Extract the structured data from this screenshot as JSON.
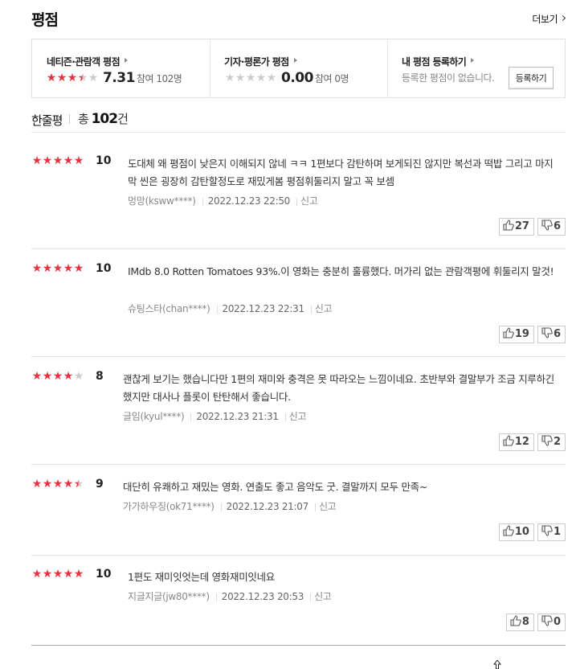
{
  "header": {
    "title": "평점",
    "more": "더보기"
  },
  "summary": {
    "netizen": {
      "label": "네티즌·관람객 평점",
      "score": "7.31",
      "participants": "참여 102명",
      "stars_fraction": 0.731
    },
    "critic": {
      "label": "기자·평론가 평점",
      "score": "0.00",
      "participants": "참여 0명",
      "stars_fraction": 0
    },
    "mine": {
      "label": "내 평점 등록하기",
      "desc": "등록한 평점이 없습니다.",
      "button": "등록하기"
    }
  },
  "reviews_header": {
    "label": "한줄평",
    "total_prefix": "총 ",
    "total_count": "102",
    "total_suffix": "건"
  },
  "reviews": [
    {
      "stars": 5,
      "score": "10",
      "text": "도대체 왜 평점이 낮은지 이해되지 않네 ㅋㅋ 1편보다 감탄하며 보게되진 않지만 복선과 떡밥 그리고 마지막 씬은 굉장히 감탄할정도로 재밌게봄 평점휘둘리지 말고 꼭 보셈",
      "user": "멍망(ksww****)",
      "date": "2022.12.23 22:50",
      "report": "신고",
      "likes": "27",
      "dislikes": "6"
    },
    {
      "stars": 5,
      "score": "10",
      "text": "IMdb 8.0 Rotten Tomatoes 93%.이 영화는 충분히 훌륭했다. 머가리 없는 관람객평에 휘둘리지 말것!",
      "user": "슈팅스타(chan****)",
      "date": "2022.12.23 22:31",
      "report": "신고",
      "likes": "19",
      "dislikes": "6"
    },
    {
      "stars": 4,
      "score": "8",
      "text": "괜찮게 보기는 했습니다만 1편의 재미와 충격은 못 따라오는 느낌이네요. 초반부와 결말부가 조금 지루하긴 했지만 대사나 플롯이 탄탄해서 좋습니다.",
      "user": "글임(kyul****)",
      "date": "2022.12.23 21:31",
      "report": "신고",
      "likes": "12",
      "dislikes": "2"
    },
    {
      "stars": 4.5,
      "score": "9",
      "text": "대단히 유쾌하고 재밌는 영화. 연출도 좋고 음악도 굿. 결말까지 모두 만족~",
      "user": "가가하우징(ok71****)",
      "date": "2022.12.23 21:07",
      "report": "신고",
      "likes": "10",
      "dislikes": "1"
    },
    {
      "stars": 5,
      "score": "10",
      "text": "1편도 재미잇엇는데 영화재미잇네요",
      "user": "지글지글(jw80****)",
      "date": "2022.12.23 20:53",
      "report": "신고",
      "likes": "8",
      "dislikes": "0"
    }
  ],
  "colors": {
    "star_on": "#e8323f",
    "star_off": "#cccccc"
  },
  "icons": {
    "like": "thumbs-up-icon",
    "dislike": "thumbs-down-icon",
    "cursor": "mouse-cursor-icon"
  }
}
